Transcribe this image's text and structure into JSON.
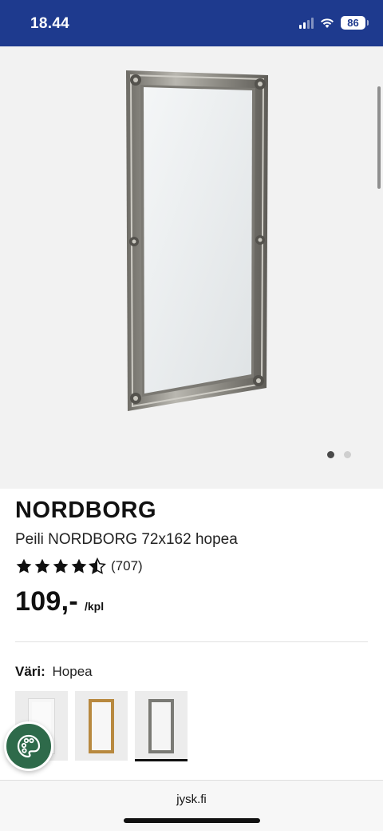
{
  "status_bar": {
    "time": "18.44",
    "battery": "86",
    "icons": [
      "cellular-signal-icon",
      "wifi-icon",
      "battery-icon"
    ],
    "background": "#1e3a8e"
  },
  "hero": {
    "image": "silver-baroque-mirror-image",
    "slide_count": 2,
    "active_slide": 1
  },
  "product": {
    "brand": "NORDBORG",
    "name": "Peili NORDBORG 72x162 hopea",
    "rating": 4.5,
    "rating_max": 5,
    "review_count": "(707)",
    "price": "109,-",
    "price_unit": "/kpl"
  },
  "color_selector": {
    "label": "Väri:",
    "selected_value": "Hopea",
    "swatches": [
      {
        "color": "#f6f6f6",
        "selected": false
      },
      {
        "color": "#b8893f",
        "selected": false
      },
      {
        "color": "#7a7a75",
        "selected": true
      }
    ]
  },
  "fab": {
    "icon": "palette-icon",
    "color": "#2e6a4a"
  },
  "browser": {
    "url": "jysk.fi"
  }
}
